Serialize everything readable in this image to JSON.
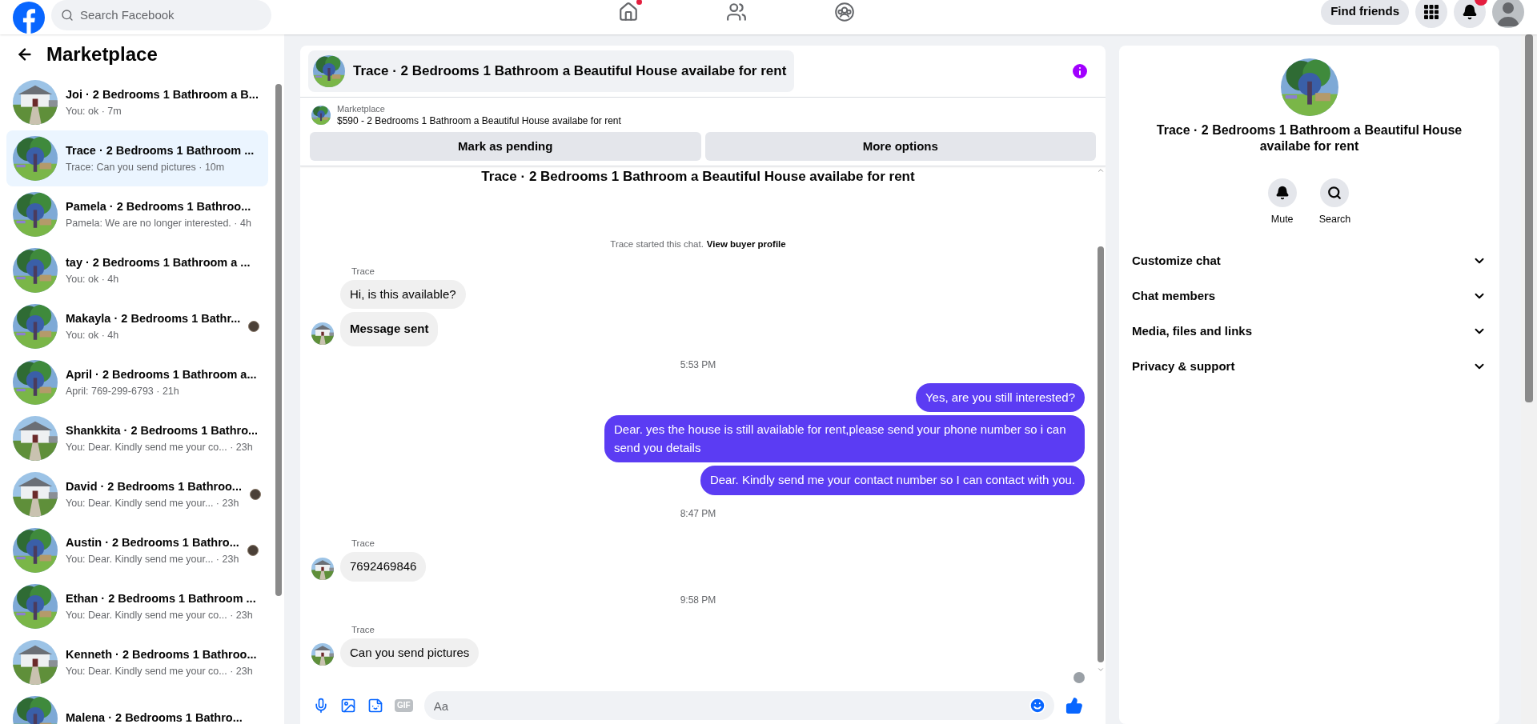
{
  "topbar": {
    "search": {
      "placeholder": "Search Facebook"
    },
    "nav": [
      {
        "kind": "home",
        "selected": false,
        "dot": true
      },
      {
        "kind": "friends",
        "selected": false,
        "dot": false
      },
      {
        "kind": "groups",
        "selected": false,
        "dot": false
      }
    ],
    "find_friends": "Find friends",
    "notifications_badge": true
  },
  "sidebar": {
    "title": "Marketplace",
    "items": [
      {
        "title": "Joi · 2 Bedrooms 1 Bathroom a B...",
        "preview": "You: ok · 7m",
        "selected": false,
        "seen": false
      },
      {
        "title": "Trace · 2 Bedrooms 1 Bathroom ...",
        "preview": "Trace: Can you send pictures · 10m",
        "selected": true,
        "seen": false
      },
      {
        "title": "Pamela · 2 Bedrooms 1 Bathroo...",
        "preview": "Pamela: We are no longer interested. · 4h",
        "selected": false,
        "seen": false
      },
      {
        "title": "tay · 2 Bedrooms 1 Bathroom a ...",
        "preview": "You: ok · 4h",
        "selected": false,
        "seen": false
      },
      {
        "title": "Makayla · 2 Bedrooms 1 Bathr...",
        "preview": "You: ok · 4h",
        "selected": false,
        "seen": true
      },
      {
        "title": "April · 2 Bedrooms 1 Bathroom a...",
        "preview": "April: 769-299-6793 · 21h",
        "selected": false,
        "seen": false
      },
      {
        "title": "Shankkita · 2 Bedrooms 1 Bathro...",
        "preview": "You: Dear. Kindly send me your co... · 23h",
        "selected": false,
        "seen": false
      },
      {
        "title": "David · 2 Bedrooms 1 Bathroo...",
        "preview": "You: Dear. Kindly send me your... · 23h",
        "selected": false,
        "seen": true
      },
      {
        "title": "Austin · 2 Bedrooms 1 Bathro...",
        "preview": "You: Dear. Kindly send me your... · 23h",
        "selected": false,
        "seen": true
      },
      {
        "title": "Ethan · 2 Bedrooms 1 Bathroom ...",
        "preview": "You: Dear. Kindly send me your co... · 23h",
        "selected": false,
        "seen": false
      },
      {
        "title": "Kenneth · 2 Bedrooms 1 Bathroo...",
        "preview": "You: Dear. Kindly send me your co... · 23h",
        "selected": false,
        "seen": false
      },
      {
        "title": "Malena · 2 Bedrooms 1 Bathro...",
        "selected": false,
        "seen": false
      }
    ]
  },
  "chat": {
    "title": "Trace · 2 Bedrooms 1 Bathroom a Beautiful House availabe for rent",
    "listing": {
      "source": "Marketplace",
      "summary": "$590 - 2 Bedrooms 1 Bathroom a Beautiful House availabe for rent"
    },
    "actions": [
      "Mark as pending",
      "More options"
    ],
    "intro_title": "Trace · 2 Bedrooms 1 Bathroom a Beautiful House availabe for rent",
    "started": {
      "text": "Trace started this chat.",
      "link": "View buyer profile"
    },
    "messages": [
      {
        "kind": "incoming",
        "sender": "Trace",
        "bubbles": [
          {
            "text": "Hi, is this available?",
            "bold": false
          },
          {
            "text": "Message sent",
            "bold": true
          }
        ]
      },
      {
        "kind": "time",
        "text": "5:53 PM"
      },
      {
        "kind": "outgoing",
        "bubbles": [
          {
            "text": "Yes, are you still interested?",
            "bold": false
          },
          {
            "text": "Dear. yes the house is still available for rent,please send your  phone number so i can send you details",
            "bold": false
          },
          {
            "text": "Dear. Kindly send me your contact number so I can contact with you.",
            "bold": false
          }
        ]
      },
      {
        "kind": "time",
        "text": "8:47 PM"
      },
      {
        "kind": "incoming",
        "sender": "Trace",
        "bubbles": [
          {
            "text": "7692469846",
            "bold": false
          }
        ]
      },
      {
        "kind": "time",
        "text": "9:58 PM"
      },
      {
        "kind": "incoming",
        "sender": "Trace",
        "bubbles": [
          {
            "text": "Can you send pictures",
            "bold": false
          }
        ]
      }
    ],
    "seen": true,
    "composer": {
      "gif": "GIF",
      "placeholder": "Aa"
    }
  },
  "details": {
    "title": "Trace · 2 Bedrooms 1 Bathroom a Beautiful House availabe for rent",
    "actions": [
      {
        "kind": "mute",
        "label": "Mute"
      },
      {
        "kind": "search",
        "label": "Search"
      }
    ],
    "sections": [
      {
        "label": "Customize chat",
        "expanded": false
      },
      {
        "label": "Chat members",
        "expanded": false
      },
      {
        "label": "Media, files and links",
        "expanded": false
      },
      {
        "label": "Privacy & support",
        "expanded": false
      }
    ]
  }
}
